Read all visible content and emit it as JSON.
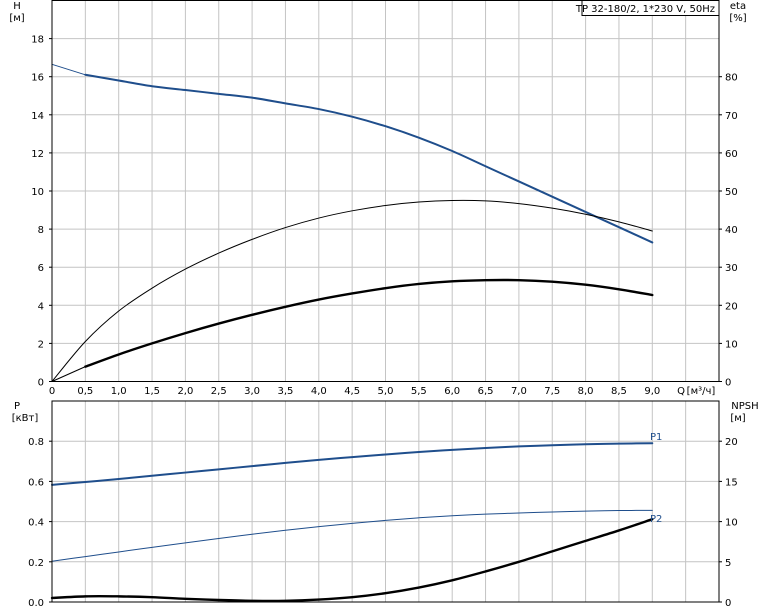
{
  "chart_data": [
    {
      "type": "line",
      "title": "TP 32-180/2, 1*230 V, 50Hz",
      "left_axis": {
        "label": "H",
        "unit": "[м]",
        "range": [
          0,
          20
        ],
        "ticks": [
          0,
          2,
          4,
          6,
          8,
          10,
          12,
          14,
          16,
          18
        ]
      },
      "right_axis": {
        "label": "eta",
        "unit": "[%]",
        "range": [
          0,
          100
        ],
        "ticks": [
          0,
          10,
          20,
          30,
          40,
          50,
          60,
          70,
          80
        ]
      },
      "x_axis": {
        "label": "Q",
        "unit": "[м³/ч]",
        "range": [
          0,
          10
        ],
        "tick_labels": [
          "0",
          "0,5",
          "1,0",
          "1,5",
          "2,0",
          "2,5",
          "3,0",
          "3,5",
          "4,0",
          "4,5",
          "5,0",
          "5,5",
          "6,0",
          "6,5",
          "7,0",
          "7,5",
          "8,0",
          "8,5",
          "9,0"
        ]
      },
      "grid": true,
      "series": [
        {
          "key": "h_thin",
          "axis": "left",
          "color": "#1f4e8c",
          "width": 0.9,
          "x": [
            0,
            0.5
          ],
          "y": [
            16.65,
            16.1
          ]
        },
        {
          "key": "h",
          "axis": "left",
          "color": "#1f4e8c",
          "width": 2,
          "x": [
            0.5,
            1,
            1.5,
            2,
            2.5,
            3,
            3.5,
            4,
            4.5,
            5,
            5.5,
            6,
            6.5,
            7,
            7.5,
            8,
            8.5,
            9
          ],
          "y": [
            16.1,
            15.8,
            15.5,
            15.3,
            15.1,
            14.9,
            14.6,
            14.3,
            13.9,
            13.4,
            12.8,
            12.1,
            11.3,
            10.5,
            9.7,
            8.9,
            8.1,
            7.3
          ]
        },
        {
          "key": "eta_total",
          "axis": "right",
          "color": "#000000",
          "width": 1,
          "x": [
            0,
            0.5,
            1,
            1.5,
            2,
            2.5,
            3,
            3.5,
            4,
            4.5,
            5,
            5.5,
            6,
            6.5,
            7,
            7.5,
            8,
            8.5,
            9
          ],
          "y": [
            0,
            10.5,
            18.5,
            24.5,
            29.5,
            33.7,
            37.3,
            40.4,
            42.9,
            44.8,
            46.2,
            47.1,
            47.5,
            47.4,
            46.7,
            45.5,
            43.9,
            41.9,
            39.5
          ]
        },
        {
          "key": "eta_hydr",
          "axis": "right",
          "color": "#000000",
          "width": 2.4,
          "x": [
            0.5,
            1,
            1.5,
            2,
            2.5,
            3,
            3.5,
            4,
            4.5,
            5,
            5.5,
            6,
            6.5,
            7,
            7.5,
            8,
            8.5,
            9
          ],
          "y": [
            3.9,
            7.1,
            10.0,
            12.7,
            15.2,
            17.5,
            19.6,
            21.5,
            23.1,
            24.5,
            25.6,
            26.3,
            26.6,
            26.6,
            26.2,
            25.4,
            24.2,
            22.7
          ]
        },
        {
          "key": "eta_start",
          "axis": "right",
          "color": "#000000",
          "width": 1,
          "x": [
            0,
            0.5
          ],
          "y": [
            0,
            3.9
          ]
        }
      ]
    },
    {
      "type": "line",
      "left_axis": {
        "label": "P",
        "unit": "[кВт]",
        "range": [
          0,
          1.0
        ],
        "ticks": [
          "0.0",
          "0.2",
          "0.4",
          "0.6",
          "0.8"
        ]
      },
      "right_axis": {
        "label": "NPSH",
        "unit": "[м]",
        "range": [
          0,
          25
        ],
        "ticks": [
          0,
          5,
          10,
          15,
          20
        ]
      },
      "x_axis": {
        "range": [
          0,
          10
        ]
      },
      "grid": true,
      "series": [
        {
          "name": "P1",
          "key": "p1",
          "axis": "left",
          "color": "#1f4e8c",
          "width": 2,
          "x": [
            0,
            0.5,
            1,
            1.5,
            2,
            2.5,
            3,
            3.5,
            4,
            4.5,
            5,
            5.5,
            6,
            6.5,
            7,
            7.5,
            8,
            8.5,
            9
          ],
          "y": [
            0.583,
            0.597,
            0.612,
            0.628,
            0.644,
            0.66,
            0.676,
            0.692,
            0.707,
            0.721,
            0.734,
            0.746,
            0.757,
            0.766,
            0.774,
            0.78,
            0.785,
            0.788,
            0.79
          ]
        },
        {
          "name": "P2",
          "key": "p2",
          "axis": "left",
          "color": "#1f4e8c",
          "width": 1,
          "x": [
            0,
            0.5,
            1,
            1.5,
            2,
            2.5,
            3,
            3.5,
            4,
            4.5,
            5,
            5.5,
            6,
            6.5,
            7,
            7.5,
            8,
            8.5,
            9
          ],
          "y": [
            0.203,
            0.226,
            0.249,
            0.272,
            0.294,
            0.316,
            0.337,
            0.357,
            0.375,
            0.391,
            0.406,
            0.419,
            0.429,
            0.437,
            0.443,
            0.448,
            0.452,
            0.455,
            0.456
          ]
        },
        {
          "key": "npsh",
          "axis": "right",
          "color": "#000000",
          "width": 2.4,
          "x": [
            0,
            0.5,
            1,
            1.5,
            2,
            2.5,
            3,
            3.5,
            4,
            4.5,
            5,
            5.5,
            6,
            6.5,
            7,
            7.5,
            8,
            8.5,
            9
          ],
          "y": [
            0.5,
            0.7,
            0.7,
            0.6,
            0.4,
            0.25,
            0.15,
            0.15,
            0.3,
            0.6,
            1.1,
            1.8,
            2.7,
            3.8,
            5.0,
            6.3,
            7.6,
            8.9,
            10.3
          ]
        }
      ]
    }
  ]
}
